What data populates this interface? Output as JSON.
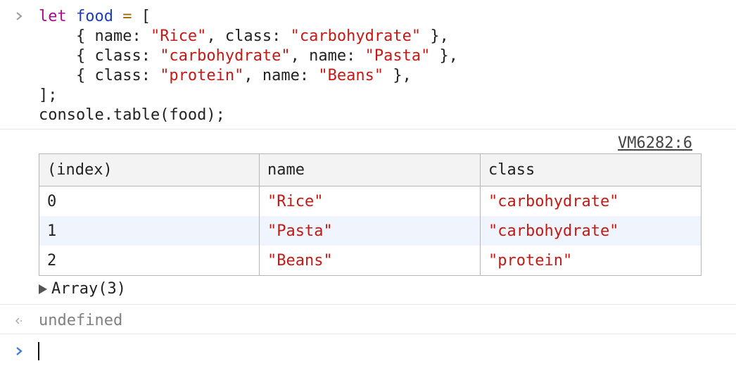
{
  "code": {
    "lines": [
      [
        {
          "t": "let",
          "c": "kw"
        },
        {
          "t": " ",
          "c": "plain"
        },
        {
          "t": "food",
          "c": "var"
        },
        {
          "t": " ",
          "c": "plain"
        },
        {
          "t": "=",
          "c": "op"
        },
        {
          "t": " [",
          "c": "plain"
        }
      ],
      [
        {
          "t": "    { name: ",
          "c": "plain"
        },
        {
          "t": "\"Rice\"",
          "c": "str"
        },
        {
          "t": ", class: ",
          "c": "plain"
        },
        {
          "t": "\"carbohydrate\"",
          "c": "str"
        },
        {
          "t": " },",
          "c": "plain"
        }
      ],
      [
        {
          "t": "    { class: ",
          "c": "plain"
        },
        {
          "t": "\"carbohydrate\"",
          "c": "str"
        },
        {
          "t": ", name: ",
          "c": "plain"
        },
        {
          "t": "\"Pasta\"",
          "c": "str"
        },
        {
          "t": " },",
          "c": "plain"
        }
      ],
      [
        {
          "t": "    { class: ",
          "c": "plain"
        },
        {
          "t": "\"protein\"",
          "c": "str"
        },
        {
          "t": ", name: ",
          "c": "plain"
        },
        {
          "t": "\"Beans\"",
          "c": "str"
        },
        {
          "t": " },",
          "c": "plain"
        }
      ],
      [
        {
          "t": "];",
          "c": "plain"
        }
      ],
      [
        {
          "t": "console.table(food);",
          "c": "plain"
        }
      ]
    ]
  },
  "source_link": "VM6282:6",
  "table": {
    "headers": [
      "(index)",
      "name",
      "class"
    ],
    "rows": [
      [
        "0",
        "\"Rice\"",
        "\"carbohydrate\""
      ],
      [
        "1",
        "\"Pasta\"",
        "\"carbohydrate\""
      ],
      [
        "2",
        "\"Beans\"",
        "\"protein\""
      ]
    ]
  },
  "array_summary": "Array(3)",
  "result_text": "undefined",
  "console_input": {
    "value": ""
  },
  "colors": {
    "keyword": "#aa0d91",
    "variable": "#1c3fb5",
    "operator": "#9a6b00",
    "string": "#c41a16",
    "prompt_active": "#3a7bd5",
    "row_alt_bg": "#f0f5fd",
    "header_bg": "#f3f3f3"
  },
  "icons": {
    "input_prompt": "chevron-right-icon",
    "result_prompt": "return-arrow-icon",
    "expand_toggle": "triangle-right-icon"
  }
}
